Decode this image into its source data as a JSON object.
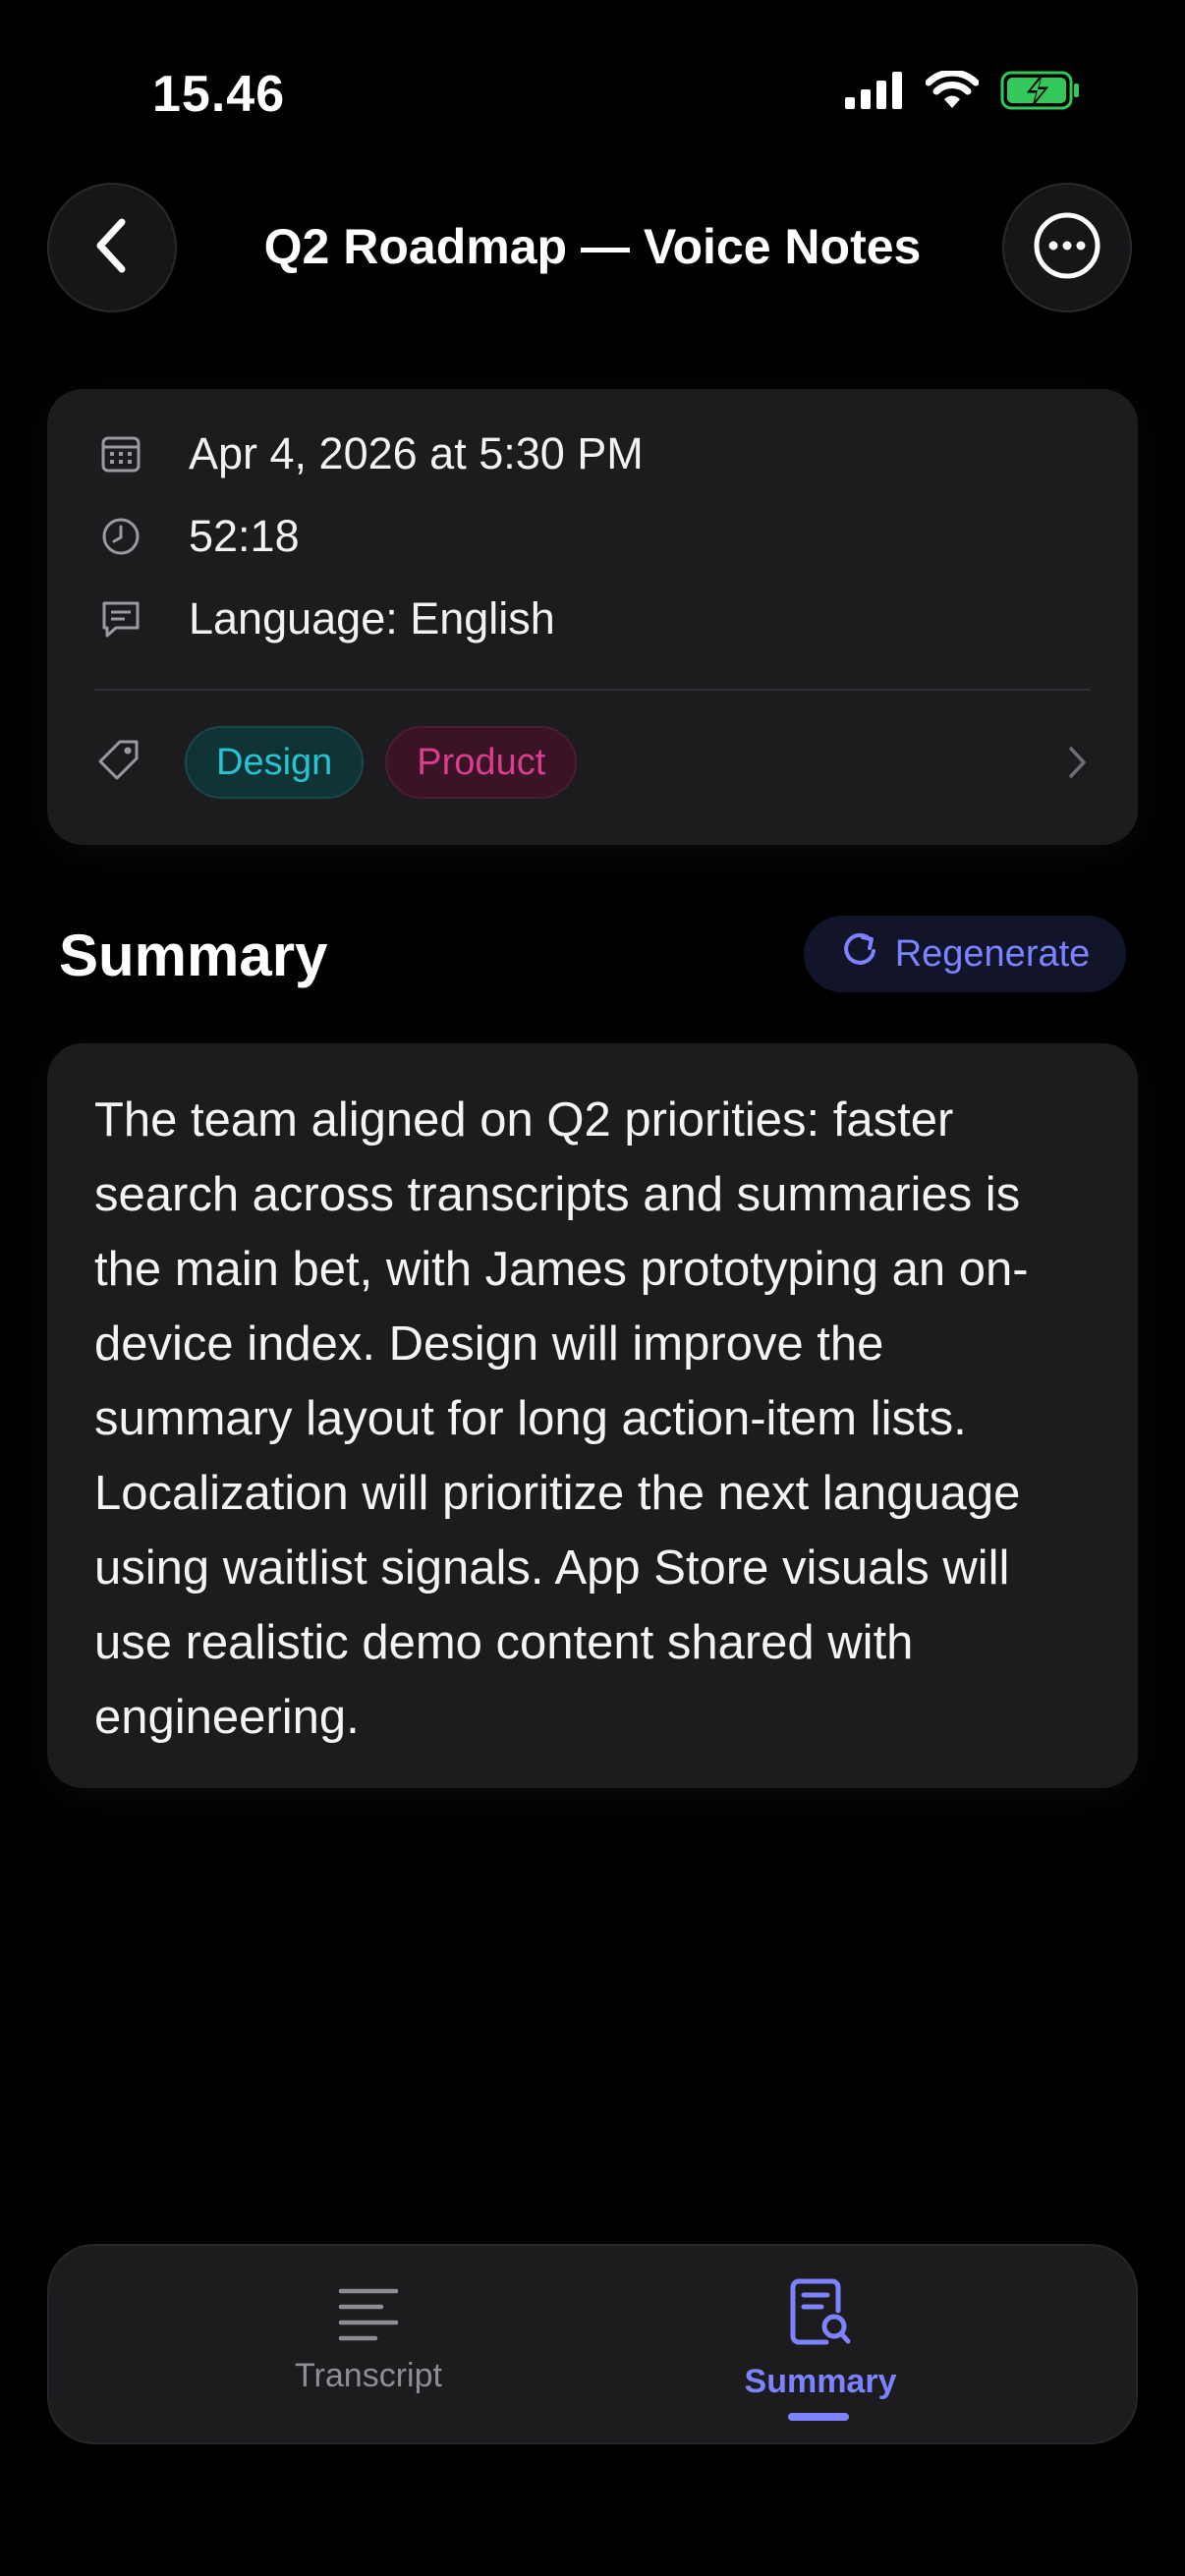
{
  "status_bar": {
    "time": "15.46",
    "icons": [
      "cellular-signal-icon",
      "wifi-icon",
      "battery-charging-icon"
    ],
    "battery_color": "#34c759"
  },
  "header": {
    "title": "Q2 Roadmap — Voice Notes",
    "back_icon": "chevron-left-icon",
    "more_icon": "ellipsis-circle-icon"
  },
  "info": {
    "date": "Apr 4, 2026 at 5:30 PM",
    "duration": "52:18",
    "language": "Language: English",
    "tags": [
      {
        "label": "Design",
        "color": "#27c3d3"
      },
      {
        "label": "Product",
        "color": "#d93d8c"
      }
    ]
  },
  "summary_section": {
    "title": "Summary",
    "regenerate_label": "Regenerate",
    "text": "The team aligned on Q2 priorities: faster search across transcripts and summaries is the main bet, with James prototyping an on-device index. Design will improve the summary layout for long action-item lists. Localization will prioritize the next language using waitlist signals. App Store visuals will use realistic demo content shared with engineering."
  },
  "tab_bar": {
    "tabs": [
      {
        "label": "Transcript",
        "icon": "text-lines-icon",
        "active": false
      },
      {
        "label": "Summary",
        "icon": "document-search-icon",
        "active": true
      }
    ],
    "accent_color": "#7d82ff"
  }
}
